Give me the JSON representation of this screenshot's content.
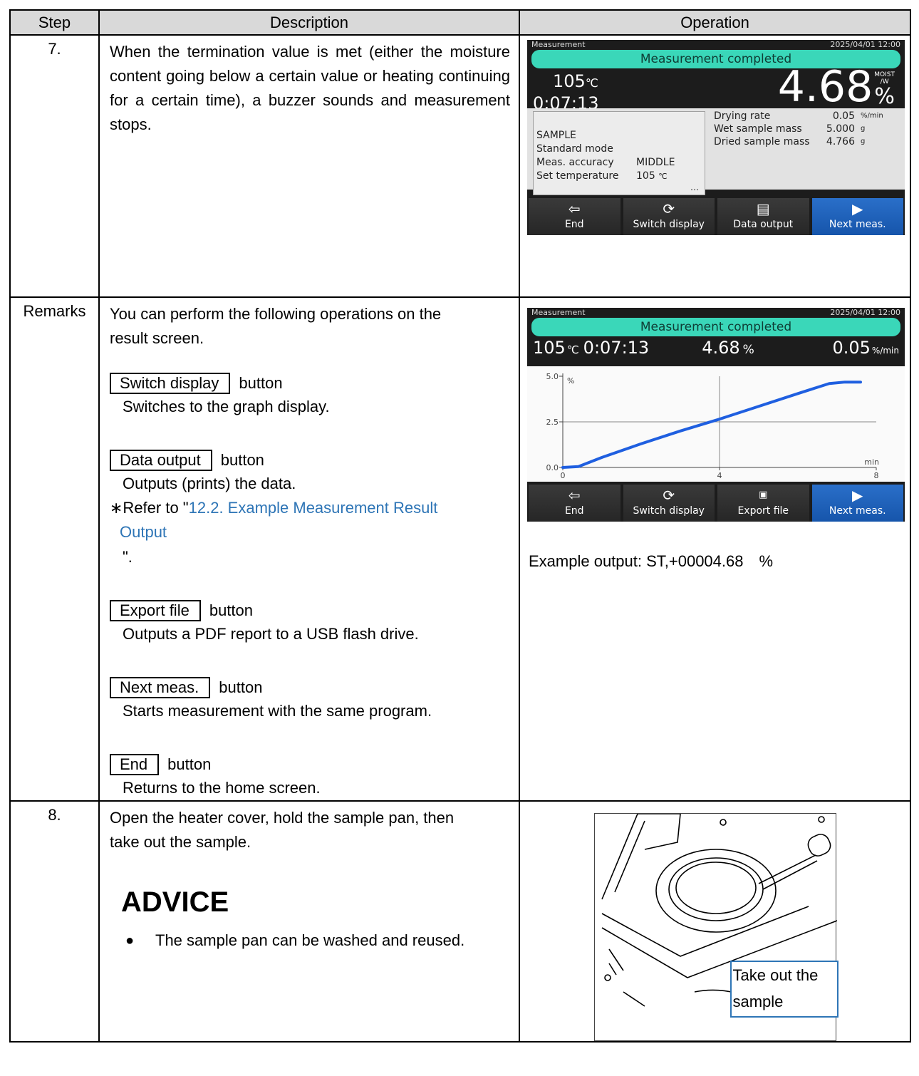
{
  "table": {
    "headers": {
      "step": "Step",
      "description": "Description",
      "operation": "Operation"
    }
  },
  "row7": {
    "step": "7.",
    "description": "When the termination value is met (either the moisture content going below a certain value or heating continuing for a certain time), a buzzer sounds and measurement stops.",
    "screen": {
      "title": "Measurement",
      "datetime": "2025/04/01 12:00",
      "banner": "Measurement completed",
      "temperature": "105",
      "temperature_unit": "℃",
      "elapsed": "0:07:13",
      "moisture_value": "4.68",
      "moisture_unit": "%",
      "mode_label_1": "MOIST",
      "mode_label_2": "/W",
      "info": {
        "sample": "SAMPLE",
        "mode": "Standard mode",
        "accuracy_label": "Meas. accuracy",
        "accuracy_value": "MIDDLE",
        "set_temp_label": "Set temperature",
        "set_temp_value": "105",
        "set_temp_unit": "℃",
        "more": "…"
      },
      "stats": [
        {
          "label": "Drying rate",
          "value": "0.05",
          "unit": "%/min"
        },
        {
          "label": "Wet sample mass",
          "value": "5.000",
          "unit": "g"
        },
        {
          "label": "Dried sample mass",
          "value": "4.766",
          "unit": "g"
        }
      ],
      "buttons": {
        "end": "End",
        "switch": "Switch display",
        "data_output": "Data output",
        "next": "Next meas."
      }
    }
  },
  "remarks": {
    "step": "Remarks",
    "intro": "You can perform the following operations on the result screen.",
    "switch_key": "Switch display",
    "switch_desc": "Switches to the graph display.",
    "data_key": "Data output",
    "data_desc": "Outputs (prints) the data.",
    "refer_prefix": "∗Refer to \"",
    "refer_link_1": "12.2. Example Measurement Result",
    "refer_link_2": "Output",
    "refer_suffix": "\".",
    "export_key": "Export file",
    "export_desc": "Outputs a PDF report to a USB flash drive.",
    "next_key": "Next meas.",
    "next_desc": "Starts measurement with the same program.",
    "end_key": "End",
    "end_desc": "Returns to the home screen.",
    "button_word": "button",
    "example_output": "Example output: ST,+00004.68　%",
    "graph_screen": {
      "title": "Measurement",
      "datetime": "2025/04/01 12:00",
      "banner": "Measurement completed",
      "temperature": "105",
      "temperature_unit": "℃",
      "elapsed": "0:07:13",
      "moisture_value": "4.68",
      "moisture_unit": "%",
      "rate_value": "0.05",
      "rate_unit": "%/min",
      "buttons": {
        "end": "End",
        "switch": "Switch display",
        "export": "Export file",
        "next": "Next meas."
      }
    }
  },
  "row8": {
    "step": "8.",
    "description": "Open the heater cover, hold the sample pan, then take out the sample.",
    "advice_title": "ADVICE",
    "advice_bullet": "The sample pan can be washed and reused.",
    "callout": "Take out the sample"
  },
  "chart_data": {
    "type": "line",
    "x": [
      0,
      0.4,
      1,
      2,
      3,
      4,
      5,
      6,
      6.8,
      7.2,
      7.6
    ],
    "y": [
      0,
      0.05,
      0.55,
      1.3,
      2.0,
      2.65,
      3.35,
      4.05,
      4.6,
      4.68,
      4.68
    ],
    "xlim": [
      0,
      8
    ],
    "ylim": [
      0,
      5.0
    ],
    "xticks": [
      "0",
      "4",
      "8"
    ],
    "yticks": [
      "0.0",
      "2.5",
      "5.0"
    ],
    "xlabel": "min",
    "ylabel": "%",
    "grid": true,
    "line_color": "#1f5fe0"
  }
}
